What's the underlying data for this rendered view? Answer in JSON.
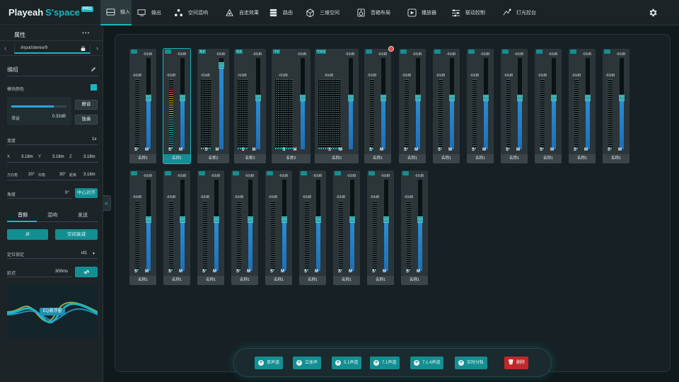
{
  "app": {
    "logo_main": "Playeah",
    "logo_accent": "S'space",
    "logo_badge": "PRO"
  },
  "tabs": [
    {
      "label": "输入",
      "icon": "input-icon",
      "active": true
    },
    {
      "label": "输出",
      "icon": "output-icon"
    },
    {
      "label": "空间混响",
      "icon": "spatial-reverb-icon"
    },
    {
      "label": "自走效果",
      "icon": "auto-effect-icon"
    },
    {
      "label": "路由",
      "icon": "routing-icon"
    },
    {
      "label": "三维空间",
      "icon": "3d-space-icon"
    },
    {
      "label": "音箱布局",
      "icon": "speaker-layout-icon"
    },
    {
      "label": "播放器",
      "icon": "player-icon"
    },
    {
      "label": "联动控制",
      "icon": "link-control-icon"
    },
    {
      "label": "灯光控台",
      "icon": "lighting-console-icon"
    }
  ],
  "sidebar": {
    "title": "属性",
    "path": "/input/stereo/9",
    "group_label": "编组",
    "color_label": "模块颜色",
    "accent_color": "#19b7c0",
    "gain_label": "增益",
    "gain_value": "0.32dB",
    "gain_level": 0.77,
    "mute_btn": "静音",
    "solo_btn": "独奏",
    "width_label": "宽度",
    "width_value": "1x",
    "coords": [
      {
        "axis": "X",
        "value": "3.18m"
      },
      {
        "axis": "Y",
        "value": "3.18m"
      },
      {
        "axis": "Z",
        "value": "3.18m"
      }
    ],
    "angles": [
      {
        "label": "方向角",
        "value": "20°"
      },
      {
        "label": "仰角",
        "value": "30°"
      },
      {
        "label": "距离",
        "value": "3.18m"
      }
    ],
    "angle_label": "角度",
    "angle_value": "0°",
    "center_btn": "中心对齐",
    "subtabs": [
      "音频",
      "混响",
      "发送"
    ],
    "phase_btn": "Ø",
    "decay_btn": "空间衰减",
    "position_lock_label": "定位锁定",
    "position_lock_value": "id1",
    "delay_label": "延迟",
    "delay_value": "300ms",
    "eq_label": "EQ悬浮窗"
  },
  "strips_row1": [
    {
      "tag": "",
      "name": "名称1",
      "db_top": "-60dB",
      "db_mid": "-60dB",
      "level": 0,
      "fader": 0.6,
      "type": "mono"
    },
    {
      "tag": "",
      "name": "名称1",
      "db_top": "-60dB",
      "db_mid": "-60dB",
      "level": 0.85,
      "fader": 0.6,
      "type": "mono",
      "selected": true
    },
    {
      "tag": "5.1",
      "name": "名称2",
      "db_top": "-60dB",
      "db_mid": "-60dB",
      "level": 0,
      "fader": 0.95,
      "type": "multi",
      "channels": 6
    },
    {
      "tag": "5.1",
      "name": "名称2",
      "db_top": "-60dB",
      "db_mid": "-60dB",
      "level": 0,
      "fader": 0.6,
      "type": "multi",
      "channels": 6
    },
    {
      "tag": "7.1",
      "name": "名称2",
      "db_top": "-60dB",
      "db_mid": "-60dB",
      "level": 0,
      "fader": 0.6,
      "type": "multi",
      "channels": 8
    },
    {
      "tag": "7.1.4",
      "name": "名称2",
      "db_top": "-60dB",
      "db_mid": "-60dB",
      "level": 0,
      "fader": 0.6,
      "type": "multi",
      "channels": 12
    },
    {
      "tag": "",
      "name": "名称1",
      "db_top": "-60dB",
      "db_mid": "-60dB",
      "level": 0,
      "fader": 0.6,
      "type": "mono",
      "badge": true
    },
    {
      "tag": "",
      "name": "名称1",
      "db_top": "-60dB",
      "db_mid": "-60dB",
      "level": 0,
      "fader": 0.6,
      "type": "mono"
    },
    {
      "tag": "",
      "name": "名称1",
      "db_top": "-60dB",
      "db_mid": "-60dB",
      "level": 0,
      "fader": 0.6,
      "type": "mono"
    },
    {
      "tag": "",
      "name": "名称1",
      "db_top": "-60dB",
      "db_mid": "-60dB",
      "level": 0,
      "fader": 0.6,
      "type": "mono"
    },
    {
      "tag": "",
      "name": "名称1",
      "db_top": "-60dB",
      "db_mid": "-60dB",
      "level": 0,
      "fader": 0.6,
      "type": "mono"
    },
    {
      "tag": "",
      "name": "名称1",
      "db_top": "-60dB",
      "db_mid": "-60dB",
      "level": 0,
      "fader": 0.6,
      "type": "mono"
    },
    {
      "tag": "",
      "name": "名称1",
      "db_top": "-60dB",
      "db_mid": "-60dB",
      "level": 0,
      "fader": 0.6,
      "type": "mono"
    },
    {
      "tag": "",
      "name": "名称1",
      "db_top": "-60dB",
      "db_mid": "-60dB",
      "level": 0,
      "fader": 0.6,
      "type": "mono"
    }
  ],
  "strips_row2": [
    {
      "tag": "",
      "name": "名称1",
      "db_top": "-60dB",
      "db_mid": "-60dB",
      "level": 0,
      "fader": 0.6,
      "type": "mono"
    },
    {
      "tag": "",
      "name": "名称1",
      "db_top": "-60dB",
      "db_mid": "-60dB",
      "level": 0,
      "fader": 0.6,
      "type": "mono"
    },
    {
      "tag": "",
      "name": "名称1",
      "db_top": "-60dB",
      "db_mid": "-60dB",
      "level": 0,
      "fader": 0.6,
      "type": "mono"
    },
    {
      "tag": "",
      "name": "名称1",
      "db_top": "-60dB",
      "db_mid": "-60dB",
      "level": 0,
      "fader": 0.6,
      "type": "mono"
    },
    {
      "tag": "",
      "name": "名称1",
      "db_top": "-60dB",
      "db_mid": "-60dB",
      "level": 0,
      "fader": 0.6,
      "type": "mono"
    },
    {
      "tag": "",
      "name": "名称1",
      "db_top": "-60dB",
      "db_mid": "-60dB",
      "level": 0,
      "fader": 0.6,
      "type": "mono"
    },
    {
      "tag": "",
      "name": "名称1",
      "db_top": "-60dB",
      "db_mid": "-60dB",
      "level": 0,
      "fader": 0.6,
      "type": "mono"
    },
    {
      "tag": "",
      "name": "名称1",
      "db_top": "-60dB",
      "db_mid": "-60dB",
      "level": 0,
      "fader": 0.6,
      "type": "mono"
    },
    {
      "tag": "",
      "name": "名称1",
      "db_top": "-60dB",
      "db_mid": "-60dB",
      "level": 0,
      "fader": 0.6,
      "type": "mono"
    }
  ],
  "strip_buttons": {
    "solo": "S",
    "mute": "M"
  },
  "bottom_buttons": [
    {
      "label": "单声道",
      "icon": "plus-icon"
    },
    {
      "label": "立体声",
      "icon": "plus-icon"
    },
    {
      "label": "5.1声道",
      "icon": "plus-icon"
    },
    {
      "label": "7.1声道",
      "icon": "plus-icon"
    },
    {
      "label": "7.1.4声道",
      "icon": "plus-icon"
    },
    {
      "label": "实时分轨",
      "icon": "plus-icon"
    },
    {
      "label": "删除",
      "icon": "trash-icon",
      "danger": true
    }
  ]
}
